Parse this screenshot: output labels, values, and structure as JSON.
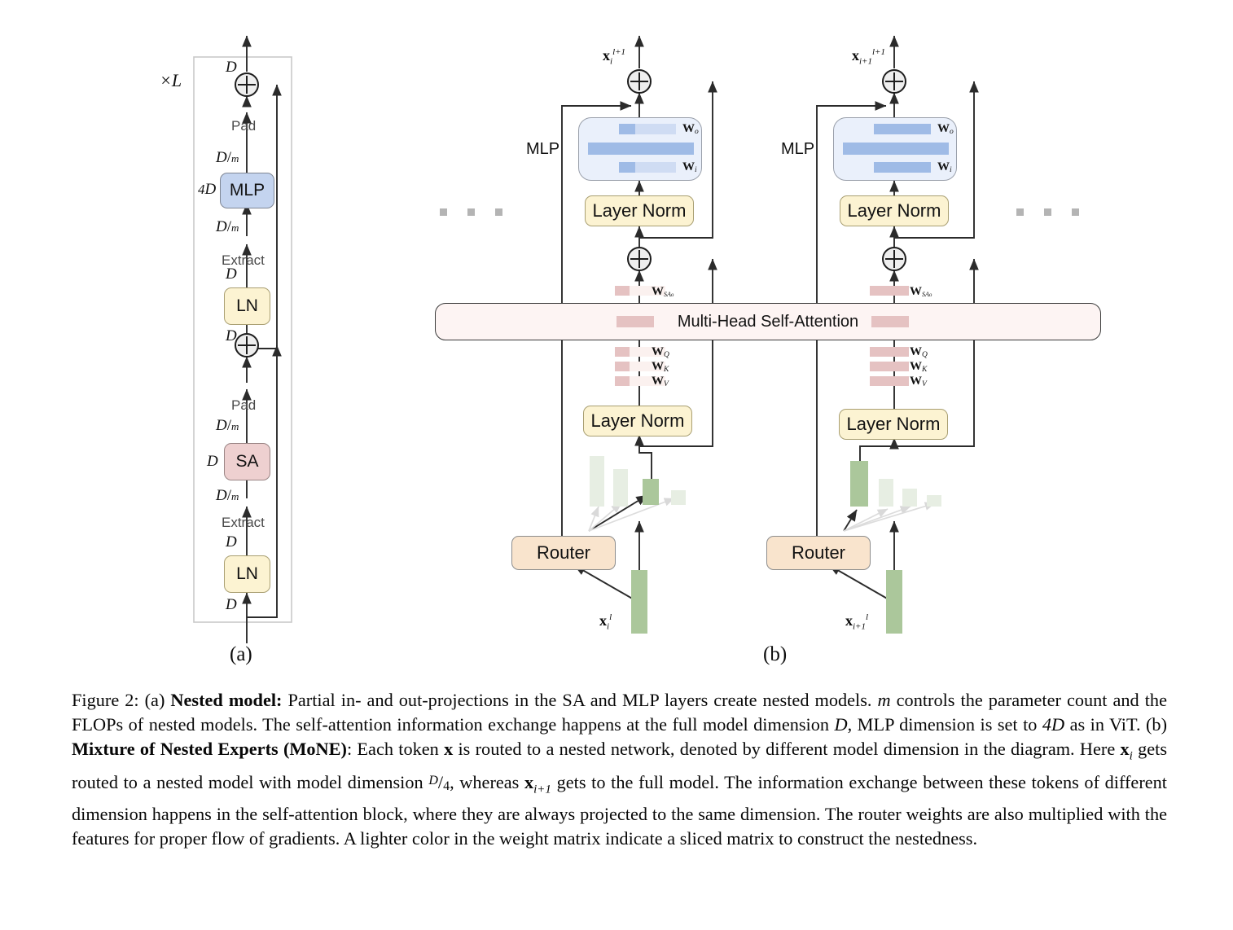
{
  "figure": {
    "number": "Figure 2:",
    "panel_a_label": "(a)",
    "panel_b_label": "(b)"
  },
  "panel_a": {
    "repeat_label": "×L",
    "blocks": [
      {
        "name": "LN",
        "label": "LN"
      },
      {
        "name": "SA",
        "label": "SA"
      },
      {
        "name": "LN",
        "label": "LN"
      },
      {
        "name": "MLP",
        "label": "MLP"
      }
    ],
    "ops": {
      "extract": "Extract",
      "pad": "Pad"
    },
    "dims": {
      "d": "D",
      "d_over_m_num": "D",
      "d_over_m_den": "m",
      "four_d_prefix": "4",
      "four_d": "4D",
      "sa_side": "D"
    },
    "sa_block_label": "SA",
    "mlp_block_label": "MLP",
    "ln_block_label": "LN"
  },
  "panel_b": {
    "mlp_group_label": "MLP",
    "layer_norm_label": "Layer Norm",
    "router_label": "Router",
    "attention_label": "Multi-Head Self-Attention",
    "weights": {
      "w_o": "W",
      "w_o_sub": "o",
      "w_i": "W",
      "w_i_sub": "i",
      "w_sa": "W",
      "w_sa_sub": "SAₒ",
      "w_q": "W",
      "w_q_sub": "Q",
      "w_k": "W",
      "w_k_sub": "K",
      "w_v": "W",
      "w_v_sub": "V"
    },
    "tokens": {
      "left_in_base": "x",
      "left_in_sub": "i",
      "left_in_sup": "l",
      "left_out_base": "x",
      "left_out_sub": "i",
      "left_out_sup": "l+1",
      "right_in_base": "x",
      "right_in_sub": "i+1",
      "right_in_sup": "l",
      "right_out_base": "x",
      "right_out_sub": "i+1",
      "right_out_sup": "l+1"
    }
  },
  "colors": {
    "mlp_block": "#c4d4ef",
    "sa_block": "#eed0d0",
    "layer_norm": "#fcf3d2",
    "router": "#f9e4cd",
    "mlp_wrapper": "#eaf0fb",
    "attention_bar": "#fdf4f3",
    "weight_bar_strong": "#e5c2c2",
    "weight_bar_light": "#fbf1ef",
    "mlp_bar_strong": "#9fbbe6",
    "mlp_bar_light": "#cfdcf3",
    "token_green_strong": "#abc79b",
    "token_green_light": "#e7eee3",
    "line": "#2b2b2b",
    "ellipsis_square": "#b4b4b4"
  },
  "caption": {
    "seg1_label": "Figure 2:",
    "seg2": " (a) ",
    "seg3_bold": "Nested model:",
    "seg4": " Partial in- and out-projections in the SA and MLP layers create nested models. ",
    "seg5_italic_m": "m",
    "seg6": " controls the parameter count and the FLOPs of nested models. The self-attention information exchange happens at the full model dimension ",
    "seg7_italic_D": "D",
    "seg8": ", MLP dimension is set to ",
    "seg9_4D": "4D",
    "seg10": " as in ViT. (b) ",
    "seg11_bold": "Mixture of Nested Experts (MoNE)",
    "seg12": ": Each token ",
    "seg13_x": "x",
    "seg14": " is routed to a nested network, denoted by different model dimension in the diagram. Here ",
    "seg15_xi": "x",
    "seg15_sub": "i",
    "seg16": " gets routed to a nested model with model dimension ",
    "seg17_frac_num": "D",
    "seg17_frac_den": "4",
    "seg18": ", whereas ",
    "seg19_xi1": "x",
    "seg19_sub": "i+1",
    "seg20": " gets to the full model. The information exchange between these tokens of different dimension happens in the self-attention block, where they are always projected to the same dimension. The router weights are also multiplied with the features for proper flow of gradients. A lighter color in the weight matrix indicate a sliced matrix to construct the nestedness."
  }
}
